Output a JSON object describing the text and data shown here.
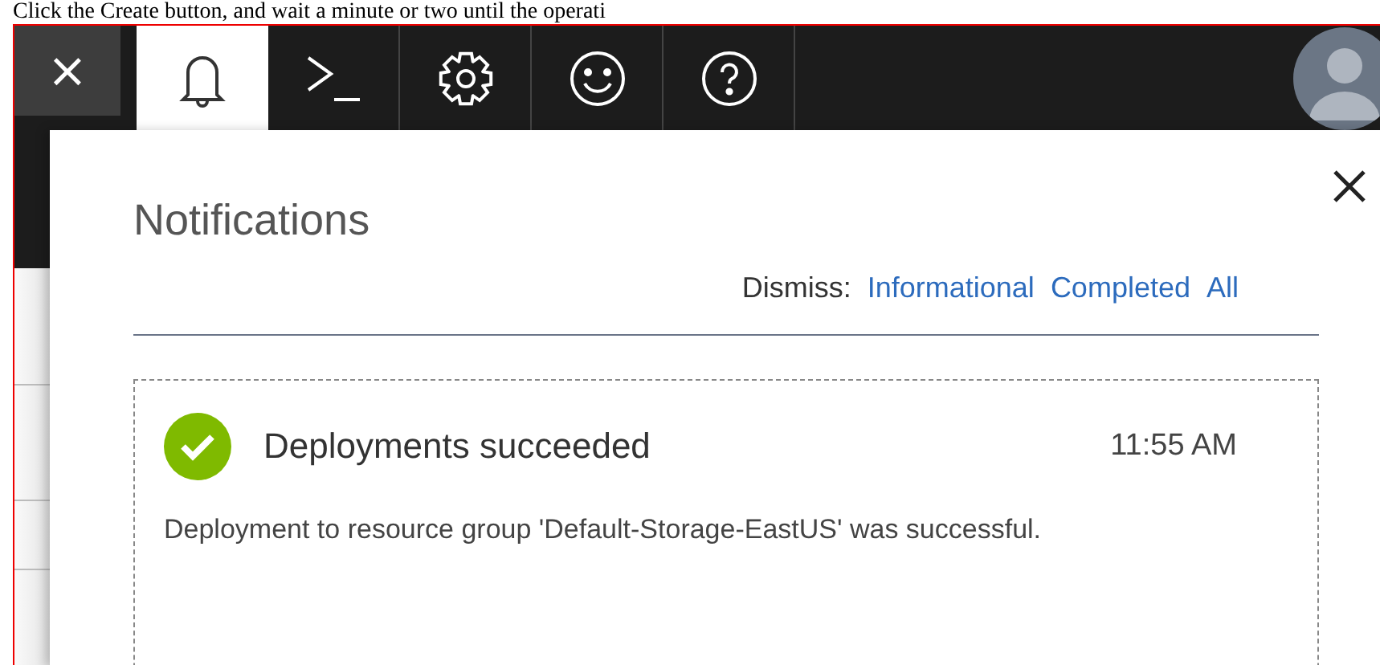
{
  "document_text": "Click the Create button, and wait a minute or two until the operati",
  "top_bar": {
    "close_label": "×",
    "tabs": [
      {
        "kind": "bell",
        "selected": true
      },
      {
        "kind": "terminal",
        "selected": false
      },
      {
        "kind": "gear",
        "selected": false
      },
      {
        "kind": "smiley",
        "selected": false
      },
      {
        "kind": "help",
        "selected": false
      }
    ]
  },
  "panel": {
    "title": "Notifications",
    "dismiss_label": "Dismiss:",
    "dismiss_links": [
      "Informational",
      "Completed",
      "All"
    ],
    "notifications": [
      {
        "kind": "success",
        "title": "Deployments succeeded",
        "time": "11:55 AM",
        "message": "Deployment to resource group 'Default-Storage-EastUS' was successful."
      }
    ]
  }
}
